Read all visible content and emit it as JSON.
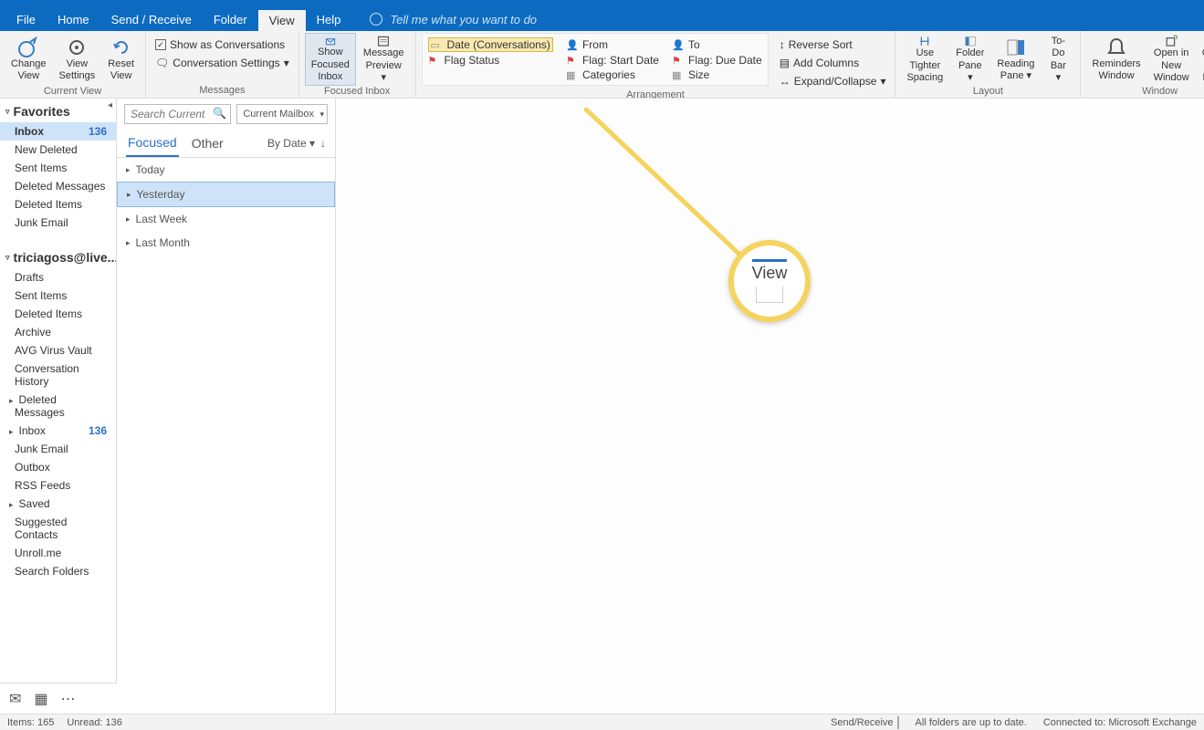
{
  "tabs": {
    "file": "File",
    "home": "Home",
    "sendreceive": "Send / Receive",
    "folder": "Folder",
    "view": "View",
    "help": "Help",
    "tellme": "Tell me what you want to do"
  },
  "ribbon": {
    "currentview": {
      "change": "Change View",
      "settings": "View Settings",
      "reset": "Reset View",
      "label": "Current View"
    },
    "messages": {
      "show_conv": "Show as Conversations",
      "conv_settings": "Conversation Settings",
      "label": "Messages"
    },
    "focused": {
      "show": "Show Focused Inbox",
      "preview": "Message Preview",
      "label": "Focused Inbox"
    },
    "arrangement": {
      "date": "Date (Conversations)",
      "from": "From",
      "to": "To",
      "flag_status": "Flag Status",
      "flag_start": "Flag: Start Date",
      "flag_due": "Flag: Due Date",
      "categories": "Categories",
      "size": "Size",
      "reverse": "Reverse Sort",
      "addcols": "Add Columns",
      "expand": "Expand/Collapse",
      "label": "Arrangement"
    },
    "layout": {
      "spacing": "Use Tighter Spacing",
      "folder": "Folder Pane",
      "reading": "Reading Pane",
      "todo": "To-Do Bar",
      "label": "Layout"
    },
    "window": {
      "reminders": "Reminders Window",
      "open": "Open in New Window",
      "close": "Close All Items",
      "label": "Window"
    }
  },
  "sidebar": {
    "favorites": "Favorites",
    "account": "triciagoss@live....",
    "fav_items": [
      {
        "name": "Inbox",
        "count": "136",
        "selected": true
      },
      {
        "name": "New Deleted"
      },
      {
        "name": "Sent Items"
      },
      {
        "name": "Deleted Messages"
      },
      {
        "name": "Deleted Items"
      },
      {
        "name": "Junk Email"
      }
    ],
    "acct_items": [
      {
        "name": "Drafts"
      },
      {
        "name": "Sent Items"
      },
      {
        "name": "Deleted Items"
      },
      {
        "name": "Archive"
      },
      {
        "name": "AVG Virus Vault"
      },
      {
        "name": "Conversation History"
      },
      {
        "name": "Deleted Messages",
        "expand": true
      },
      {
        "name": "Inbox",
        "count": "136",
        "expand": true
      },
      {
        "name": "Junk Email"
      },
      {
        "name": "Outbox"
      },
      {
        "name": "RSS Feeds"
      },
      {
        "name": "Saved",
        "expand": true
      },
      {
        "name": "Suggested Contacts"
      },
      {
        "name": "Unroll.me"
      },
      {
        "name": "Search Folders"
      }
    ]
  },
  "search": {
    "placeholder": "Search Current Mailbox",
    "scope": "Current Mailbox"
  },
  "mailpane": {
    "focused": "Focused",
    "other": "Other",
    "bydate": "By Date",
    "groups": [
      "Today",
      "Yesterday",
      "Last Week",
      "Last Month"
    ]
  },
  "callout": "View",
  "status": {
    "items": "Items: 165",
    "unread": "Unread: 136",
    "sr": "Send/Receive",
    "uptodate": "All folders are up to date.",
    "connected": "Connected to: Microsoft Exchange"
  }
}
